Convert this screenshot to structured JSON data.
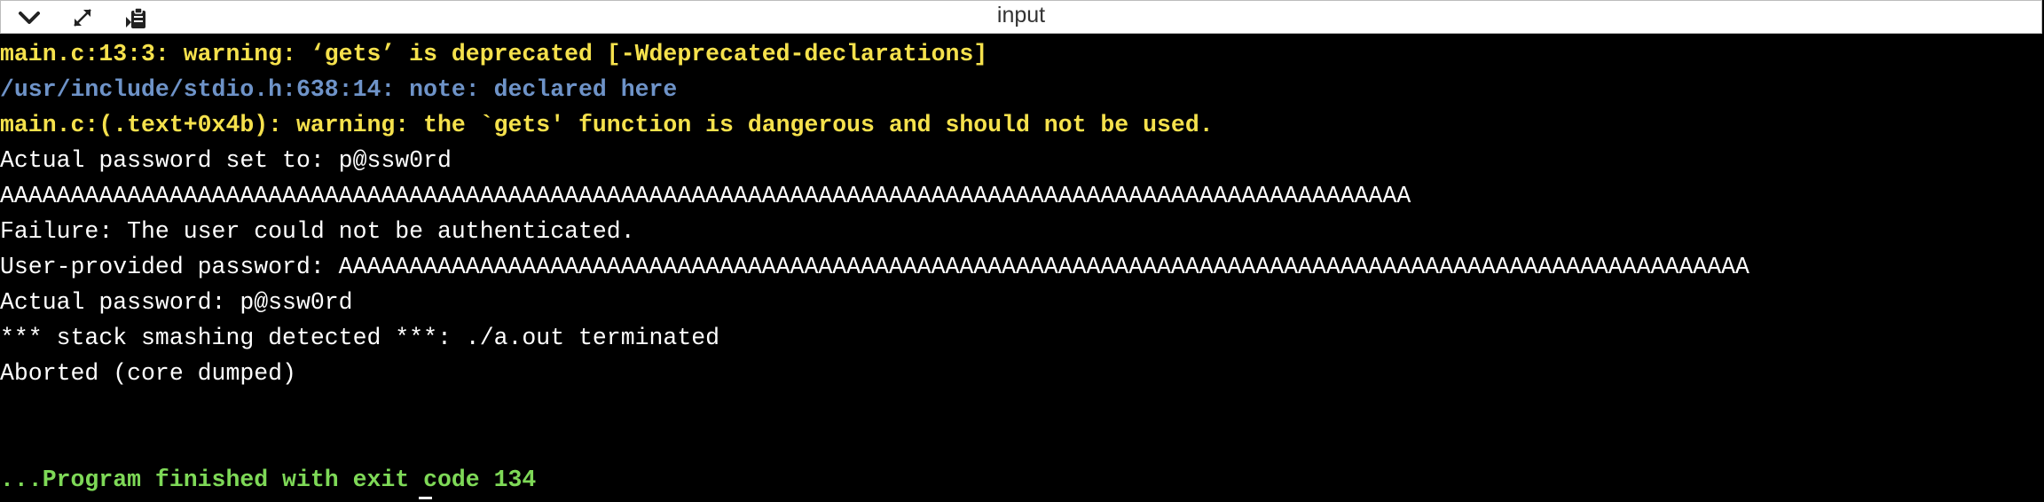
{
  "window": {
    "title": "input"
  },
  "toolbar": {
    "icons": [
      "chevron-down-icon",
      "expand-icon",
      "clipboard-icon"
    ]
  },
  "colors": {
    "warning": "#f5e14c",
    "note": "#6e93c8",
    "output": "#ffffff",
    "finished": "#7ed957",
    "background": "#000000"
  },
  "console": {
    "lines": [
      "main.c:13:3: warning: ‘gets’ is deprecated [-Wdeprecated-declarations]",
      "/usr/include/stdio.h:638:14: note: declared here",
      "main.c:(.text+0x4b): warning: the `gets' function is dangerous and should not be used.",
      "Actual password set to: p@ssw0rd",
      "AAAAAAAAAAAAAAAAAAAAAAAAAAAAAAAAAAAAAAAAAAAAAAAAAAAAAAAAAAAAAAAAAAAAAAAAAAAAAAAAAAAAAAAAAAAAAAAAAAAA",
      "Failure: The user could not be authenticated.",
      "User-provided password: AAAAAAAAAAAAAAAAAAAAAAAAAAAAAAAAAAAAAAAAAAAAAAAAAAAAAAAAAAAAAAAAAAAAAAAAAAAAAAAAAAAAAAAAAAAAAAAAAAAA",
      "Actual password: p@ssw0rd",
      "*** stack smashing detected ***: ./a.out terminated",
      "Aborted (core dumped)"
    ],
    "finished": "...Program finished with exit code 134"
  }
}
